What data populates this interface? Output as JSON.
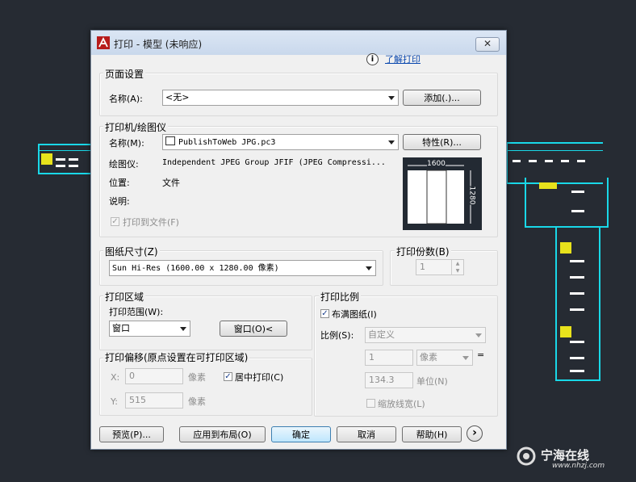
{
  "dialog": {
    "title": "打印 - 模型 (未响应)",
    "close_label": "✕",
    "help_icon": "i",
    "learn_link": "了解打印"
  },
  "page_setup": {
    "group_label": "页面设置",
    "name_label": "名称(A):",
    "name_value": "<无>",
    "add_button": "添加(.)..."
  },
  "printer": {
    "group_label": "打印机/绘图仪",
    "name_label": "名称(M):",
    "name_value": "PublishToWeb JPG.pc3",
    "properties_button": "特性(R)...",
    "plotter_label": "绘图仪:",
    "plotter_value": "Independent JPEG Group JFIF (JPEG Compressi...",
    "location_label": "位置:",
    "location_value": "文件",
    "description_label": "说明:",
    "print_to_file_label": "打印到文件(F)",
    "print_to_file_checked": true,
    "preview_width_label": "1600",
    "preview_height_label": "1280"
  },
  "paper_size": {
    "group_label": "图纸尺寸(Z)",
    "value": "Sun Hi-Res (1600.00 x 1280.00 像素)"
  },
  "copies": {
    "group_label": "打印份数(B)",
    "value": "1"
  },
  "plot_area": {
    "group_label": "打印区域",
    "range_label": "打印范围(W):",
    "range_value": "窗口",
    "window_button": "窗口(O)<"
  },
  "plot_offset": {
    "group_label": "打印偏移(原点设置在可打印区域)",
    "x_label": "X:",
    "x_value": "0",
    "x_unit": "像素",
    "y_label": "Y:",
    "y_value": "515",
    "y_unit": "像素",
    "center_label": "居中打印(C)",
    "center_checked": true
  },
  "plot_scale": {
    "group_label": "打印比例",
    "fit_label": "布满图纸(I)",
    "fit_checked": true,
    "scale_label": "比例(S):",
    "scale_value": "自定义",
    "value1": "1",
    "unit1": "像素",
    "equals": "=",
    "value2": "134.3",
    "unit2": "单位(N)",
    "lineweight_label": "缩放线宽(L)",
    "lineweight_checked": false
  },
  "footer": {
    "preview_button": "预览(P)...",
    "apply_button": "应用到布局(O)",
    "ok_button": "确定",
    "cancel_button": "取消",
    "help_button": "帮助(H)",
    "expand_icon": "›"
  },
  "watermark": {
    "brand": "宁海在线",
    "url": "www.nhzj.com"
  },
  "colors": {
    "background": "#262b33",
    "cad_cyan": "#19d8e8",
    "cad_yellow": "#e8e21c",
    "dialog": "#f0f0f0",
    "default_button": "#bee6fd"
  }
}
